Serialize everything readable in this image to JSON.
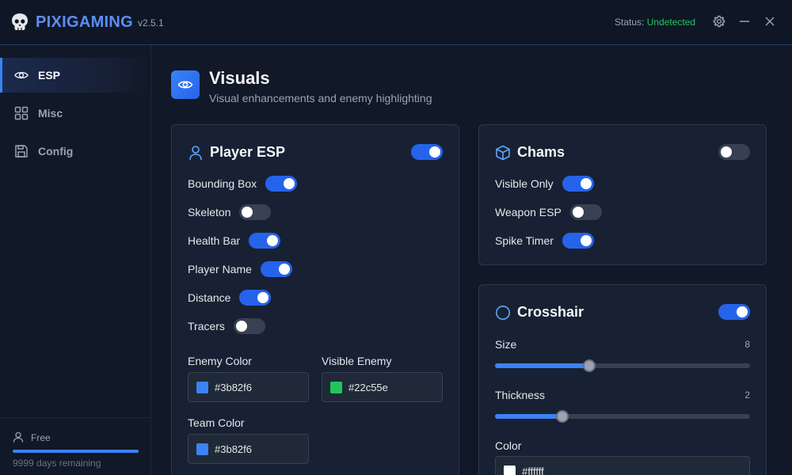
{
  "app": {
    "brand": "PIXIGAMING",
    "version": "v2.5.1",
    "status_label": "Status:",
    "status_value": "Undetected",
    "status_color": "#22c55e",
    "accent_color": "#3b82f6"
  },
  "sidebar": {
    "items": [
      {
        "label": "ESP",
        "icon": "eye-icon",
        "active": true
      },
      {
        "label": "Misc",
        "icon": "grid-icon",
        "active": false
      },
      {
        "label": "Config",
        "icon": "save-icon",
        "active": false
      }
    ],
    "plan": {
      "label": "Free",
      "days": "9999 days remaining",
      "progress": 1.0
    }
  },
  "page": {
    "title": "Visuals",
    "subtitle": "Visual enhancements and enemy highlighting"
  },
  "player_esp": {
    "title": "Player ESP",
    "enabled": true,
    "options": [
      {
        "label": "Bounding Box",
        "on": true
      },
      {
        "label": "Skeleton",
        "on": false
      },
      {
        "label": "Health Bar",
        "on": true
      },
      {
        "label": "Player Name",
        "on": true
      },
      {
        "label": "Distance",
        "on": true
      },
      {
        "label": "Tracers",
        "on": false
      }
    ],
    "colors": [
      {
        "label": "Enemy Color",
        "value": "#3b82f6"
      },
      {
        "label": "Visible Enemy",
        "value": "#22c55e"
      },
      {
        "label": "Team Color",
        "value": "#3b82f6"
      }
    ]
  },
  "chams": {
    "title": "Chams",
    "enabled": false,
    "options": [
      {
        "label": "Visible Only",
        "on": true
      },
      {
        "label": "Weapon ESP",
        "on": false
      },
      {
        "label": "Spike Timer",
        "on": true
      }
    ]
  },
  "crosshair": {
    "title": "Crosshair",
    "enabled": true,
    "size": {
      "label": "Size",
      "value": "8",
      "fraction": 0.37
    },
    "thickness": {
      "label": "Thickness",
      "value": "2",
      "fraction": 0.265
    },
    "color": {
      "label": "Color",
      "value": "#ffffff"
    }
  }
}
